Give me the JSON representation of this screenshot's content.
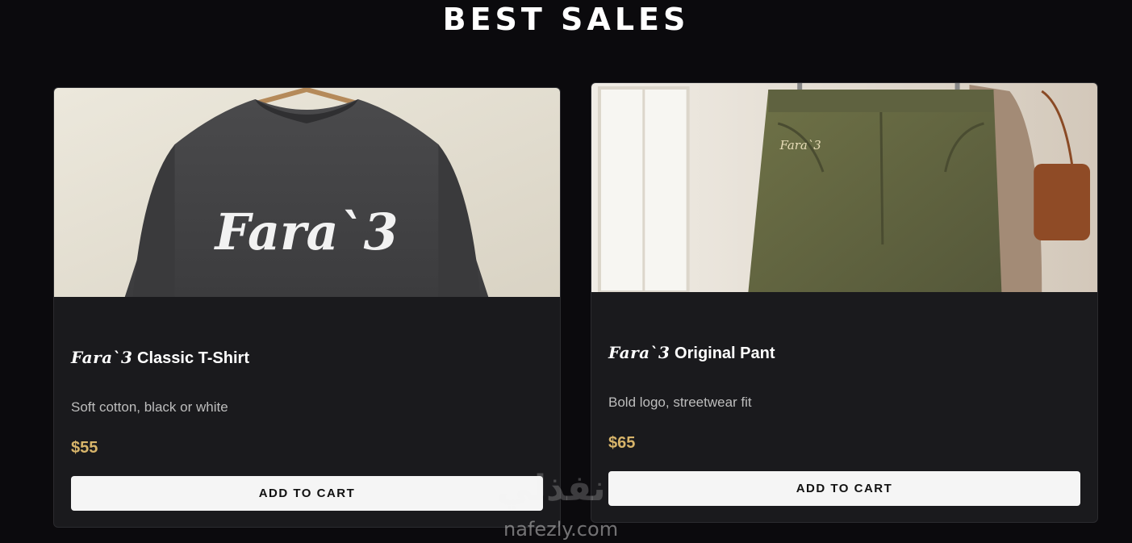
{
  "section": {
    "title": "BEST SALES"
  },
  "products": [
    {
      "brand": "Fara`3",
      "name": "Classic T-Shirt",
      "description": "Soft cotton, black or white",
      "price": "$55",
      "button_label": "ADD TO CART",
      "image_text": "Fara`3"
    },
    {
      "brand": "Fara`3",
      "name": "Original Pant",
      "description": "Bold logo, streetwear fit",
      "price": "$65",
      "button_label": "ADD TO CART",
      "image_text": "Fara`3"
    }
  ],
  "watermark": {
    "arabic": "نفذلي",
    "latin": "nafezly.com"
  },
  "colors": {
    "background": "#0b0a0d",
    "card": "#1a1a1d",
    "price": "#d7b46a",
    "button": "#f5f5f5"
  }
}
